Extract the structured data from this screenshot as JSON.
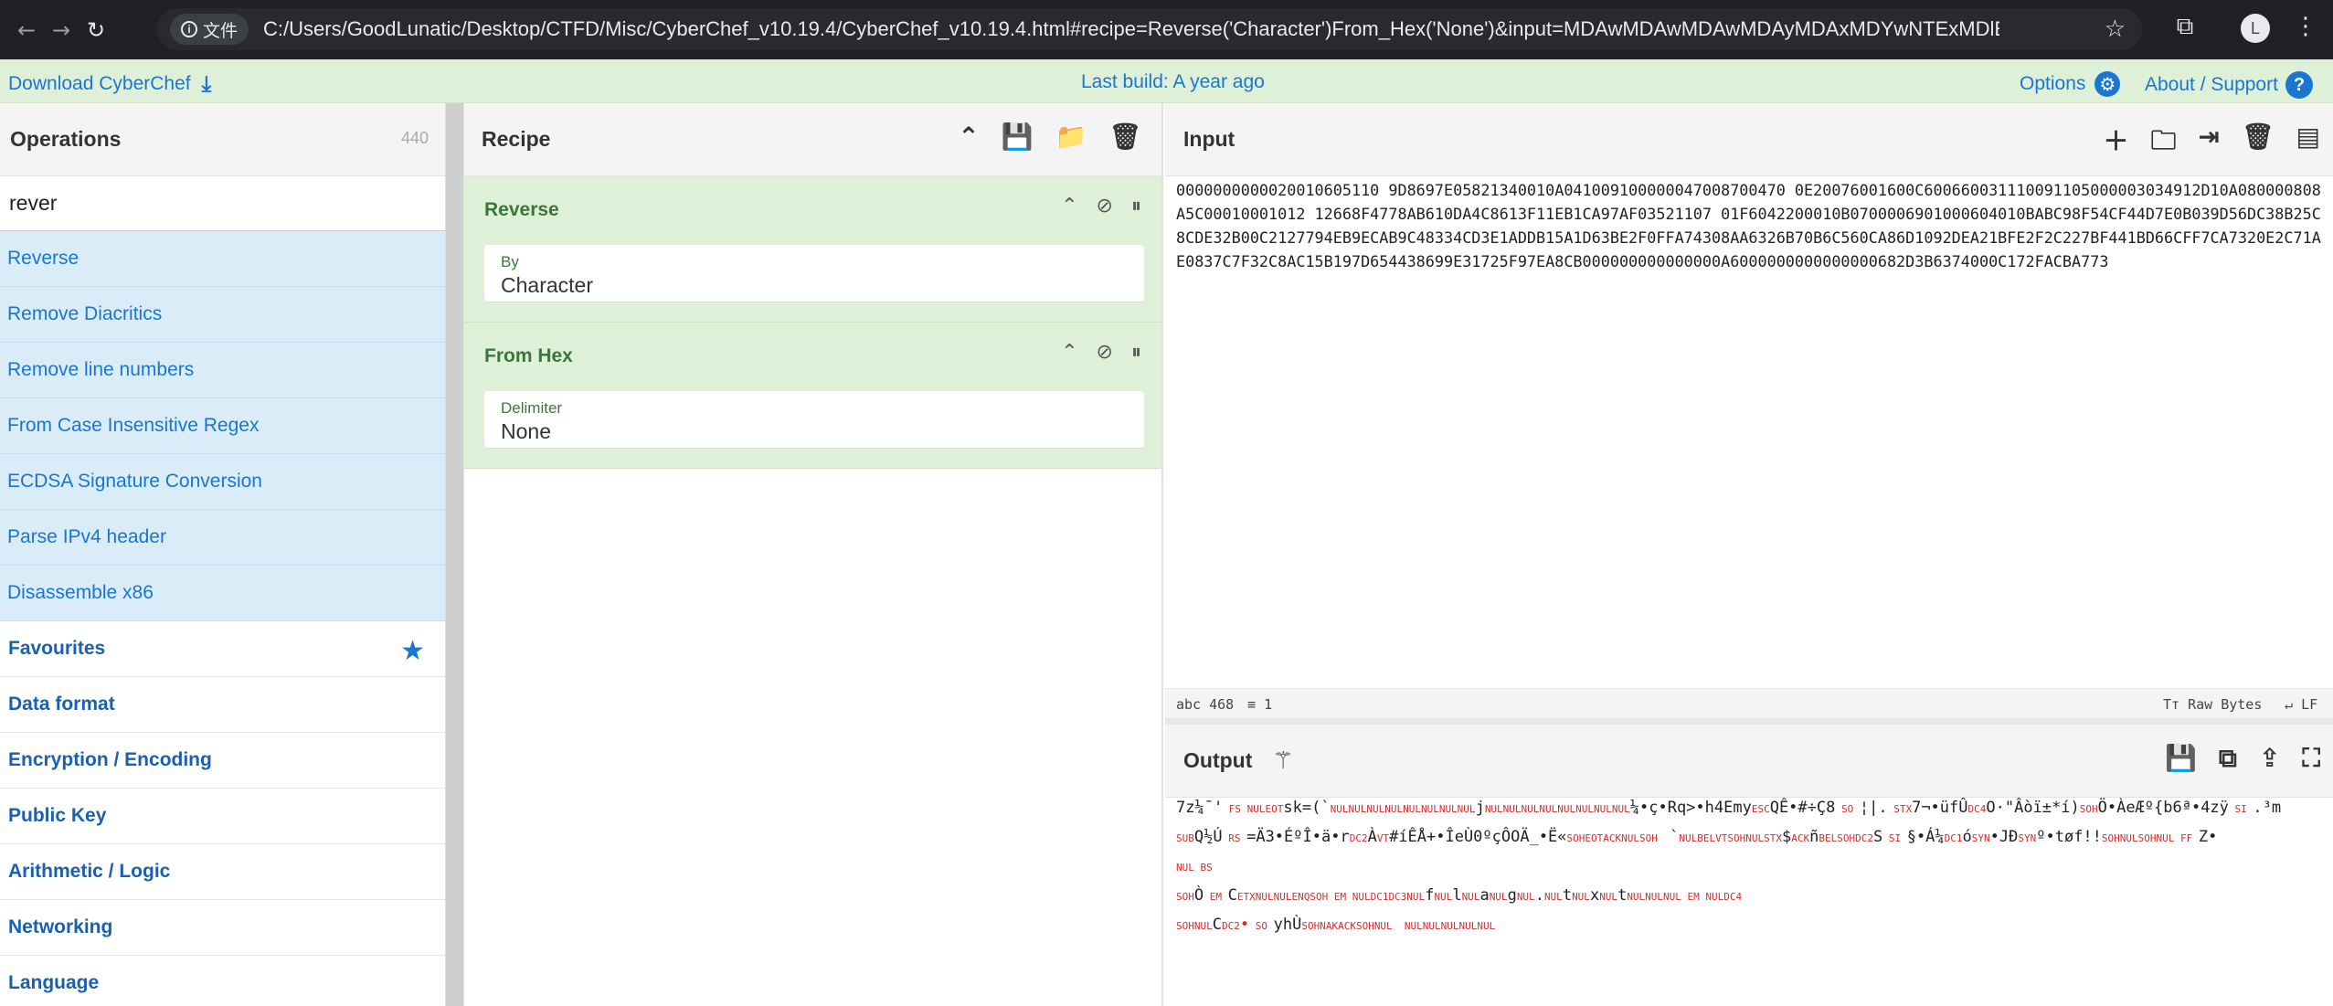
{
  "browser": {
    "file_chip": "文件",
    "url": "C:/Users/GoodLunatic/Desktop/CTFD/Misc/CyberChef_v10.19.4/CyberChef_v10.19.4.html#recipe=Reverse('Character')From_Hex('None')&input=MDAwMDAwMDAwMDAyMDAxMDYwNTExMDlEOD...",
    "avatar": "L"
  },
  "banner": {
    "download": "Download CyberChef",
    "last_build": "Last build: A year ago",
    "options": "Options",
    "about": "About / Support"
  },
  "operations": {
    "title": "Operations",
    "count": "440",
    "search_value": "rever",
    "results": [
      "Reverse",
      "Remove Diacritics",
      "Remove line numbers",
      "From Case Insensitive Regex",
      "ECDSA Signature Conversion",
      "Parse IPv4 header",
      "Disassemble x86"
    ],
    "categories": [
      "Favourites",
      "Data format",
      "Encryption / Encoding",
      "Public Key",
      "Arithmetic / Logic",
      "Networking",
      "Language"
    ]
  },
  "recipe": {
    "title": "Recipe",
    "steps": [
      {
        "name": "Reverse",
        "arg_label": "By",
        "arg_value": "Character"
      },
      {
        "name": "From Hex",
        "arg_label": "Delimiter",
        "arg_value": "None"
      }
    ]
  },
  "input": {
    "title": "Input",
    "text": "0000000000020010605110 9D8697E05821340010A041009100000047008700470 0E20076001600C600660031110091105000003034912D10A080000808A5C00010001012 12668F4778AB610DA4C8613F11EB1CA97AF03521107 01F6042200010B0700006901000604010BABC98F54CF44D7E0B039D56DC38B25C8CDE32B00C2127794EB9ECAB9C48334CD3E1ADDB15A1D63BE2F0FFA74308AA6326B70B6C560CA86D1092DEA21BFE2F2C227BF441BD66CFF7CA7320E2C71AE0837C7F32C8AC15B197D654438699E31725F97EA8CB000000000000000A6000000000000000682D3B6374000C172FACBA773",
    "chars": "468",
    "lines": "1",
    "raw_bytes": "Raw Bytes",
    "eol": "LF"
  },
  "output": {
    "title": "Output",
    "line1": "7z¼¯'",
    "line1b": "sk=(`",
    "line1c": "j",
    "line1d": "¼•ç•Rq>•h4Emy",
    "line1e": "QÊ•#÷Ç8",
    "line1f": "¦|.",
    "line1g": "7¬•üfÛ",
    "line1h": "O·\"Âòï±*í)",
    "line1i": "Ö•ÀeÆº{b6ª•4zÿ",
    "line1j": ".³m",
    "line2a": "Q½Ú",
    "line2b": "=Ä3•ÉºÎ•ä•r",
    "line2c": "À",
    "line2d": "#íÊÅ+•ÎeÙ0ºçÔOÄ_•Ë«",
    "line2e": "`",
    "line2f": "$",
    "line2g": "ñ",
    "line2h": "S",
    "line2i": "§•Á¼",
    "line2j": "ó",
    "line2k": "•JÐ",
    "line2l": "º•tøf!!",
    "line2m": "Z•",
    "line4a": "Ò",
    "line4b": "C",
    "line4c": "f",
    "line4d": "l",
    "line4e": "a",
    "line4f": "g",
    "line4g": ".",
    "line4h": "t",
    "line4i": "x",
    "line4j": "t",
    "line5a": "C",
    "line5b": "yhÙ"
  }
}
